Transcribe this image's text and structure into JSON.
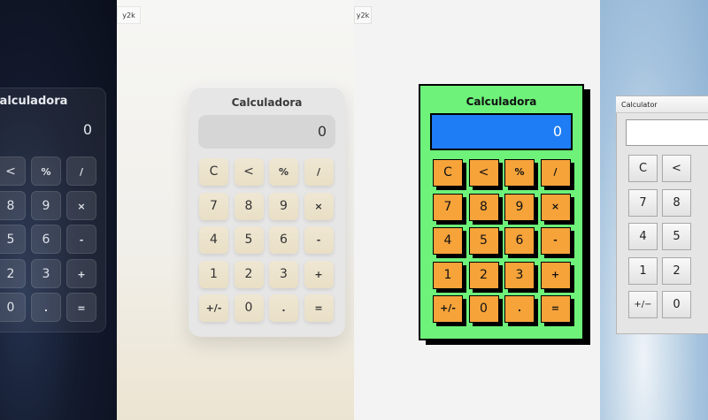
{
  "glass": {
    "title": "Calculadora",
    "display": "0",
    "keys": [
      "<",
      "%",
      "/",
      "8",
      "9",
      "×",
      "5",
      "6",
      "-",
      "2",
      "3",
      "+",
      "0",
      ".",
      "="
    ]
  },
  "soft": {
    "tag": "y2k",
    "title": "Calculadora",
    "display": "0",
    "keys": [
      "C",
      "<",
      "%",
      "/",
      "7",
      "8",
      "9",
      "×",
      "4",
      "5",
      "6",
      "-",
      "1",
      "2",
      "3",
      "+",
      "+/-",
      "0",
      ".",
      "="
    ]
  },
  "brutal": {
    "tag": "y2k",
    "title": "Calculadora",
    "display": "0",
    "keys": [
      "C",
      "<",
      "%",
      "/",
      "7",
      "8",
      "9",
      "×",
      "4",
      "5",
      "6",
      "-",
      "1",
      "2",
      "3",
      "+",
      "+/-",
      "0",
      ".",
      "="
    ]
  },
  "retro": {
    "title": "Calculator",
    "display": "",
    "keys": [
      "C",
      "<",
      "7",
      "8",
      "4",
      "5",
      "1",
      "2",
      "+/−",
      "0"
    ]
  },
  "colors": {
    "glass_bg": "#131a2d",
    "soft_key": "#efe7d3",
    "brutal_card": "#6ef27a",
    "brutal_display": "#1e7cf4",
    "brutal_key": "#f6a33a",
    "retro_sky": "#a5c3de"
  }
}
